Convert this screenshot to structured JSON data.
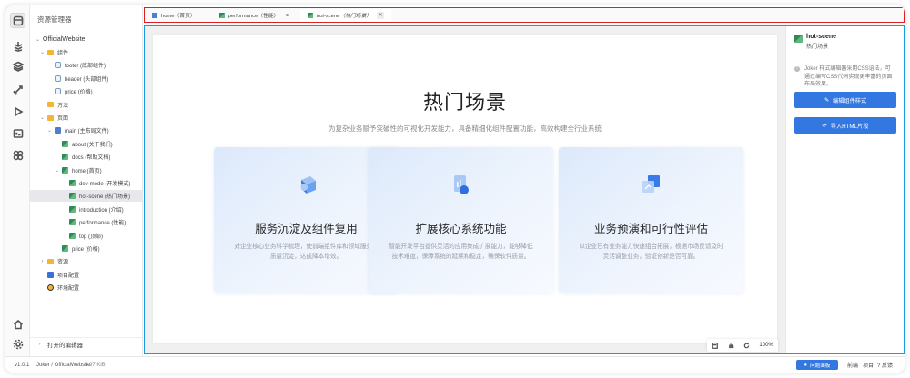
{
  "app": {
    "version": "v1.0.1",
    "breadcrumb": "Joker / OfficialWebsite",
    "size": "6.97 KiB"
  },
  "explorer": {
    "title": "资源管理器",
    "project": "OfficialWebsite",
    "items": [
      {
        "label": "组件",
        "level": 1,
        "type": "folder",
        "chev": "v"
      },
      {
        "label": "footer (底部组件)",
        "level": 2,
        "type": "comp"
      },
      {
        "label": "header (头部组件)",
        "level": 2,
        "type": "comp"
      },
      {
        "label": "price (价格)",
        "level": 2,
        "type": "comp"
      },
      {
        "label": "方法",
        "level": 1,
        "type": "folder"
      },
      {
        "label": "页面",
        "level": 1,
        "type": "folder",
        "chev": "v"
      },
      {
        "label": "main (主布局文件)",
        "level": 2,
        "type": "mainpage",
        "chev": "v"
      },
      {
        "label": "about (关于我们)",
        "level": 3,
        "type": "page"
      },
      {
        "label": "docs (帮助文档)",
        "level": 3,
        "type": "page"
      },
      {
        "label": "home (首页)",
        "level": 3,
        "type": "page",
        "chev": "v"
      },
      {
        "label": "dev-mode (开发模式)",
        "level": 4,
        "type": "page"
      },
      {
        "label": "hot-scene (热门场景)",
        "level": 4,
        "type": "page",
        "selected": true
      },
      {
        "label": "introduction (介绍)",
        "level": 4,
        "type": "page"
      },
      {
        "label": "performance (性能)",
        "level": 4,
        "type": "page"
      },
      {
        "label": "top (顶部)",
        "level": 4,
        "type": "page"
      },
      {
        "label": "price (价格)",
        "level": 3,
        "type": "page"
      },
      {
        "label": "资源",
        "level": 1,
        "type": "folder",
        "chev": ">"
      },
      {
        "label": "项目配置",
        "level": 1,
        "type": "cfg"
      },
      {
        "label": "环境配置",
        "level": 1,
        "type": "env"
      }
    ],
    "open_editors": "打开的编辑器"
  },
  "tabs": [
    {
      "label": "home（首页）",
      "state": "normal"
    },
    {
      "label": "performance（性能）",
      "state": "modified"
    },
    {
      "label": "hot-scene（热门场景）",
      "state": "active"
    }
  ],
  "hero": {
    "title": "热门场景",
    "subtitle": "为复杂业务赋予突破性的可视化开发能力，具备精细化组件配置功能，高效构建全行业系统"
  },
  "cards": [
    {
      "title": "服务沉淀及组件复用",
      "desc": "对企业核心业务科学梳理，使前端组件库和领域服务高质量沉淀，达成降本增效。"
    },
    {
      "title": "扩展核心系统功能",
      "desc": "智能开发平台提供灵活的应用集成扩展能力，能够降低技术难度，保障系统的延续和稳定，确保软件质量。"
    },
    {
      "title": "业务预演和可行性评估",
      "desc": "以企业已有业务能力快速组合拓展，根据市场反馈及时灵活调整业务，验证创新是否可靠。"
    }
  ],
  "zoom": {
    "value": "100%"
  },
  "props": {
    "name": "hot-scene",
    "sub": "热门场景",
    "hint": "Joker 样式编辑器采用CSS语法，可通过编写CSS代码实现更丰富的页面布局效果。",
    "btn_style": "编辑组件样式",
    "btn_import": "导入HTML片段"
  },
  "status": {
    "problems": "问题面板",
    "frontend": "前端",
    "project": "项目",
    "feedback": "反馈"
  },
  "colors": {
    "accent": "#3377e0",
    "tab_highlight": "#e02020",
    "editor_highlight": "#1a9be0"
  }
}
